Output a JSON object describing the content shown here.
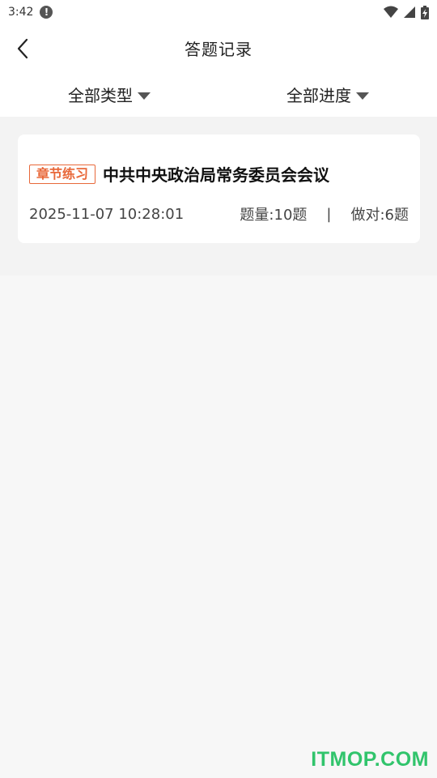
{
  "status_bar": {
    "time": "3:42",
    "alert_icon": "alert-circle-icon",
    "icons": [
      "wifi-icon",
      "signal-icon",
      "battery-charging-icon"
    ]
  },
  "header": {
    "back_icon": "chevron-left-icon",
    "title": "答题记录"
  },
  "filters": [
    {
      "label": "全部类型",
      "icon": "caret-down-icon"
    },
    {
      "label": "全部进度",
      "icon": "caret-down-icon"
    }
  ],
  "records": [
    {
      "tag": "章节练习",
      "title": "中共中央政治局常务委员会会议",
      "datetime": "2025-11-07 10:28:01",
      "question_count": "题量:10题",
      "separator": "|",
      "correct_count": "做对:6题"
    }
  ],
  "colors": {
    "accent": "#e8683a",
    "watermark": "#31c46c",
    "background": "#f7f7f7"
  },
  "watermark": "ITMOP.COM"
}
